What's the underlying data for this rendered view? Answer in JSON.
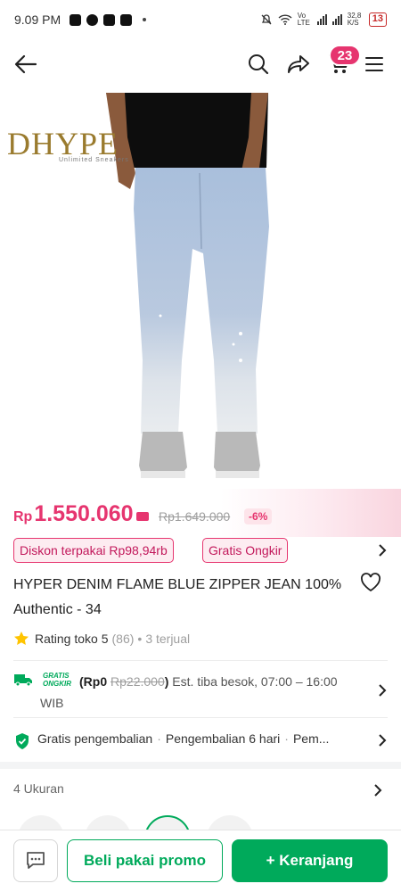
{
  "status_bar": {
    "time": "9.09 PM",
    "network_label": "Vo LTE",
    "speed": "32,8 K/S",
    "battery": "13"
  },
  "header": {
    "cart_count": "23",
    "icons": [
      "back-arrow-icon",
      "search-icon",
      "share-icon",
      "cart-icon",
      "menu-icon"
    ]
  },
  "product": {
    "store_logo": "DHYPE",
    "store_logo_sub": "Unlimited Sneakers",
    "currency": "Rp",
    "price": "1.550.060",
    "original_price": "Rp1.649.000",
    "discount": "-6%",
    "chips": [
      "Diskon terpakai Rp98,94rb",
      "Gratis Ongkir"
    ],
    "title": "HYPER DENIM FLAME BLUE ZIPPER JEAN 100% Authentic - 34",
    "rating_label": "Rating toko 5",
    "rating_count": "(86)",
    "sold": "3 terjual",
    "shipping": {
      "badge_top": "GRATIS",
      "badge_bottom": "ONGKIR",
      "cost": "(Rp0",
      "old_cost": "Rp22.000",
      "close_paren": ")",
      "estimate": "Est. tiba besok, 07:00 – 16:00 WIB"
    },
    "returns": [
      "Gratis pengembalian",
      "Pengembalian 6 hari",
      "Pem..."
    ],
    "sizes_label": "4 Ukuran"
  },
  "bottom_bar": {
    "promo_label": "Beli pakai promo",
    "cart_label": "+ Keranjang"
  },
  "colors": {
    "accent_pink": "#e6356f",
    "accent_green": "#00aa5b"
  }
}
